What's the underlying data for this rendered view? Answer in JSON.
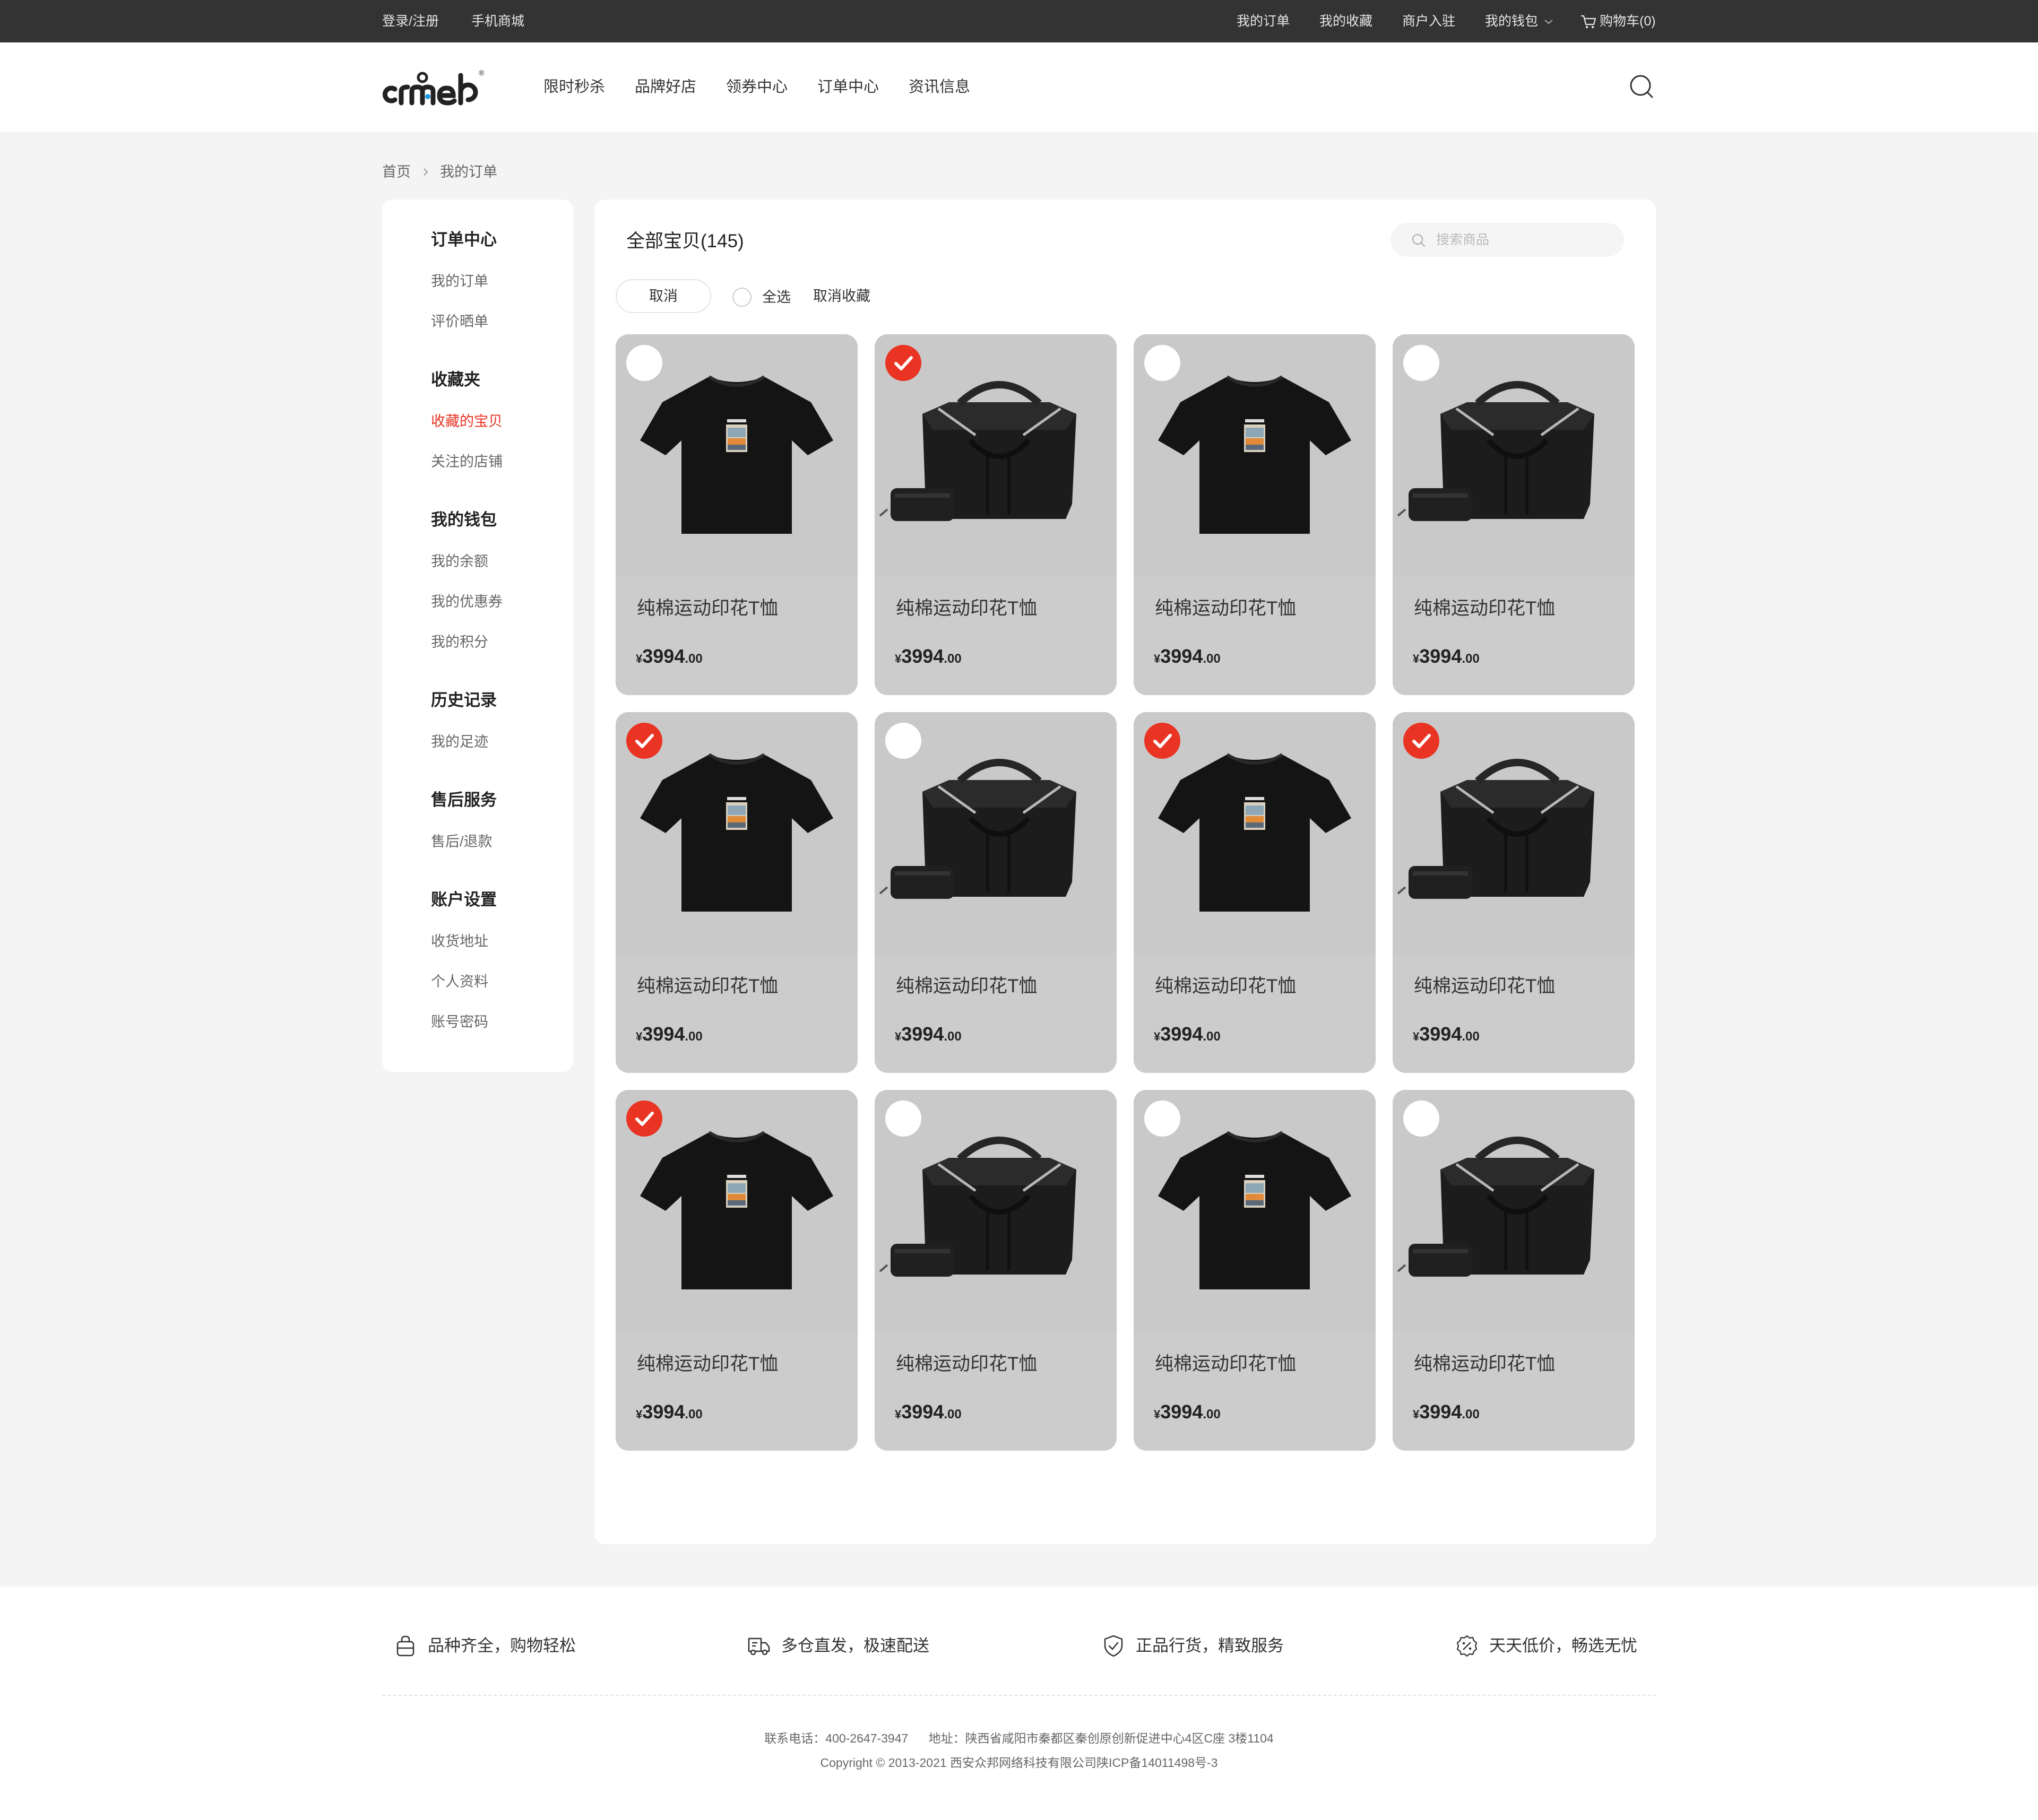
{
  "topbar": {
    "login": "登录/注册",
    "mobile_mall": "手机商城",
    "my_orders": "我的订单",
    "my_favorites": "我的收藏",
    "merchant_join": "商户入驻",
    "my_wallet": "我的钱包",
    "cart": "购物车(0)"
  },
  "header": {
    "nav": [
      "限时秒杀",
      "品牌好店",
      "领券中心",
      "订单中心",
      "资讯信息"
    ]
  },
  "breadcrumb": {
    "home": "首页",
    "current": "我的订单"
  },
  "sidebar": {
    "groups": [
      {
        "title": "订单中心",
        "items": [
          "我的订单",
          "评价晒单"
        ]
      },
      {
        "title": "收藏夹",
        "items": [
          "收藏的宝贝",
          "关注的店铺"
        ]
      },
      {
        "title": "我的钱包",
        "items": [
          "我的余额",
          "我的优惠券",
          "我的积分"
        ]
      },
      {
        "title": "历史记录",
        "items": [
          "我的足迹"
        ]
      },
      {
        "title": "售后服务",
        "items": [
          "售后/退款"
        ]
      },
      {
        "title": "账户设置",
        "items": [
          "收货地址",
          "个人资料",
          "账号密码"
        ]
      }
    ],
    "active_item": "收藏的宝贝"
  },
  "main": {
    "title": "全部宝贝(145)",
    "search_placeholder": "搜索商品",
    "cancel_label": "取消",
    "select_all_label": "全选",
    "uncollect_label": "取消收藏"
  },
  "products": [
    {
      "name": "纯棉运动印花T恤",
      "currency": "¥",
      "price_int": "3994",
      "price_dec": ".00",
      "image": "tshirt",
      "selected": false
    },
    {
      "name": "纯棉运动印花T恤",
      "currency": "¥",
      "price_int": "3994",
      "price_dec": ".00",
      "image": "bag",
      "selected": true
    },
    {
      "name": "纯棉运动印花T恤",
      "currency": "¥",
      "price_int": "3994",
      "price_dec": ".00",
      "image": "tshirt",
      "selected": false
    },
    {
      "name": "纯棉运动印花T恤",
      "currency": "¥",
      "price_int": "3994",
      "price_dec": ".00",
      "image": "bag",
      "selected": false
    },
    {
      "name": "纯棉运动印花T恤",
      "currency": "¥",
      "price_int": "3994",
      "price_dec": ".00",
      "image": "tshirt",
      "selected": true
    },
    {
      "name": "纯棉运动印花T恤",
      "currency": "¥",
      "price_int": "3994",
      "price_dec": ".00",
      "image": "bag",
      "selected": false
    },
    {
      "name": "纯棉运动印花T恤",
      "currency": "¥",
      "price_int": "3994",
      "price_dec": ".00",
      "image": "tshirt",
      "selected": true
    },
    {
      "name": "纯棉运动印花T恤",
      "currency": "¥",
      "price_int": "3994",
      "price_dec": ".00",
      "image": "bag",
      "selected": true
    },
    {
      "name": "纯棉运动印花T恤",
      "currency": "¥",
      "price_int": "3994",
      "price_dec": ".00",
      "image": "tshirt",
      "selected": true
    },
    {
      "name": "纯棉运动印花T恤",
      "currency": "¥",
      "price_int": "3994",
      "price_dec": ".00",
      "image": "bag",
      "selected": false
    },
    {
      "name": "纯棉运动印花T恤",
      "currency": "¥",
      "price_int": "3994",
      "price_dec": ".00",
      "image": "tshirt",
      "selected": false
    },
    {
      "name": "纯棉运动印花T恤",
      "currency": "¥",
      "price_int": "3994",
      "price_dec": ".00",
      "image": "bag",
      "selected": false
    }
  ],
  "footer": {
    "features": [
      {
        "icon": "bag-icon",
        "text": "品种齐全，购物轻松"
      },
      {
        "icon": "truck-icon",
        "text": "多仓直发，极速配送"
      },
      {
        "icon": "shield-check-icon",
        "text": "正品行货，精致服务"
      },
      {
        "icon": "discount-badge-icon",
        "text": "天天低价，畅选无忧"
      }
    ],
    "contact": "联系电话：400-2647-3947      地址：陕西省咸阳市秦都区秦创原创新促进中心4区C座 3楼1104",
    "copyright": "Copyright © 2013-2021 西安众邦网络科技有限公司陕ICP备14011498号-3"
  },
  "colors": {
    "accent": "#e93323",
    "topbar_bg": "#333333",
    "page_bg": "#f4f4f4",
    "card_bg": "#cccccc"
  }
}
